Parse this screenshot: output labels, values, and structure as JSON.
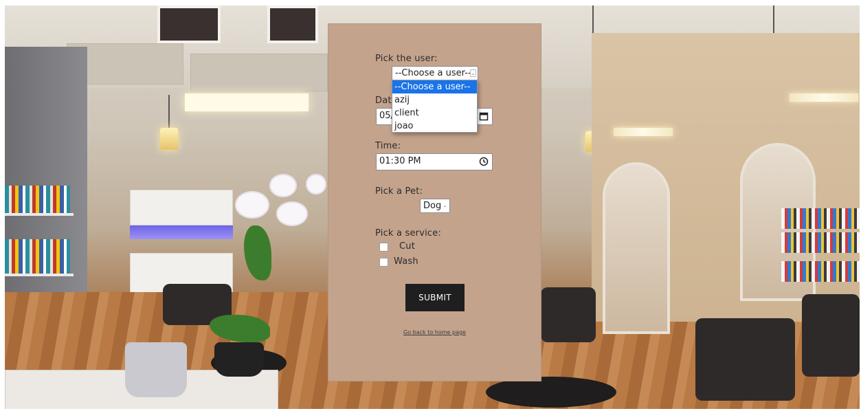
{
  "form": {
    "user_label": "Pick the user:",
    "user_selected": "--Choose a user--",
    "user_options": [
      "--Choose a user--",
      "azij",
      "client",
      "joao"
    ],
    "date_label": "Dat",
    "date_value": "05/",
    "time_label": "Time:",
    "time_value": "01:30 PM",
    "pet_label": "Pick a Pet:",
    "pet_selected": "Dog",
    "service_label": "Pick a service:",
    "services": [
      {
        "label": "Cut",
        "checked": false
      },
      {
        "label": "Wash",
        "checked": false
      }
    ],
    "submit_label": "SUBMIT",
    "back_link": "Go back to home page"
  },
  "icons": {
    "date": "calendar-icon",
    "time": "clock-icon",
    "select": "chevron-down-icon"
  },
  "colors": {
    "card": "#c4a38d",
    "submit": "#1f1f1f",
    "option_highlight": "#1a73e8"
  }
}
